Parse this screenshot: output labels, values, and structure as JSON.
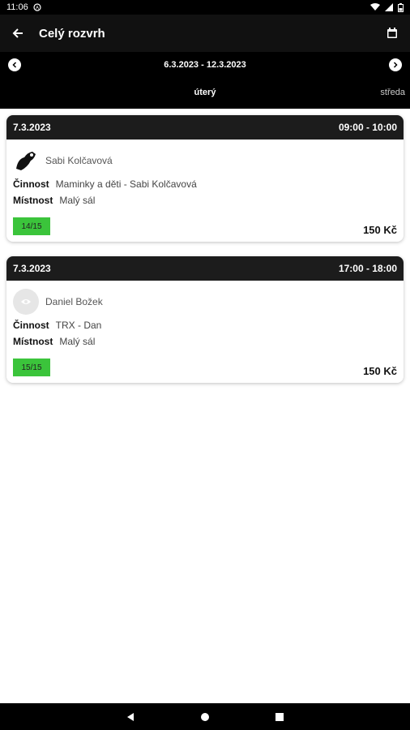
{
  "status_bar": {
    "time": "11:06"
  },
  "app_bar": {
    "title": "Celý rozvrh"
  },
  "week": {
    "range": "6.3.2023 - 12.3.2023"
  },
  "day_tabs": {
    "active": "úterý",
    "next": "středa"
  },
  "lessons": [
    {
      "date": "7.3.2023",
      "time": "09:00 - 10:00",
      "trainer": "Sabi Kolčavová",
      "activity_label": "Činnost",
      "activity": "Maminky a děti - Sabi Kolčavová",
      "room_label": "Místnost",
      "room": "Malý sál",
      "capacity": "14/15",
      "price": "150 Kč"
    },
    {
      "date": "7.3.2023",
      "time": "17:00 - 18:00",
      "trainer": "Daniel Božek",
      "activity_label": "Činnost",
      "activity": "TRX - Dan",
      "room_label": "Místnost",
      "room": "Malý sál",
      "capacity": "15/15",
      "price": "150 Kč"
    }
  ],
  "colors": {
    "capacity_badge": "#3bc43b",
    "header": "#1c1c1c"
  }
}
